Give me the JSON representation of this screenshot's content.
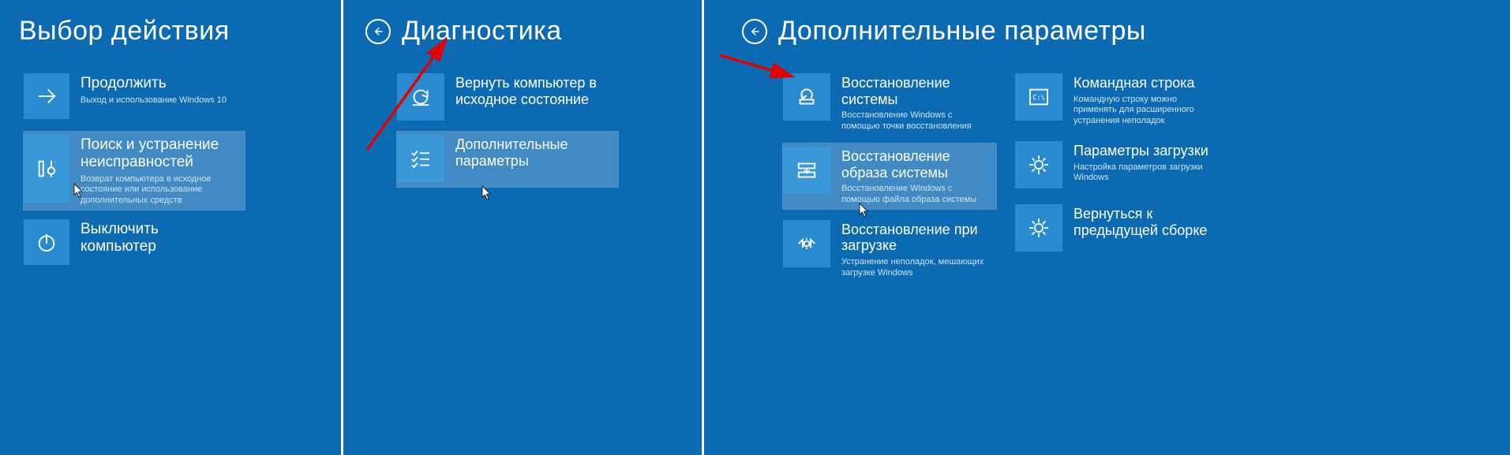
{
  "panel1": {
    "title": "Выбор действия",
    "tiles": [
      {
        "title": "Продолжить",
        "desc": "Выход и использование Windows 10"
      },
      {
        "title": "Поиск и устранение неисправностей",
        "desc": "Возврат компьютера в исходное состояние или использование дополнительных средств"
      },
      {
        "title": "Выключить компьютер",
        "desc": ""
      }
    ]
  },
  "panel2": {
    "title": "Диагностика",
    "tiles": [
      {
        "title": "Вернуть компьютер в исходное состояние",
        "desc": ""
      },
      {
        "title": "Дополнительные параметры",
        "desc": ""
      }
    ]
  },
  "panel3": {
    "title": "Дополнительные параметры",
    "col1": [
      {
        "title": "Восстановление системы",
        "desc": "Восстановление Windows с помощью точки восстановления"
      },
      {
        "title": "Восстановление образа системы",
        "desc": "Восстановление Windows с помощью файла образа системы"
      },
      {
        "title": "Восстановление при загрузке",
        "desc": "Устранение неполадок, мешающих загрузке Windows"
      }
    ],
    "col2": [
      {
        "title": "Командная строка",
        "desc": "Командную строку можно применять для расширенного устранения неполадок"
      },
      {
        "title": "Параметры загрузки",
        "desc": "Настройка параметров загрузки Windows"
      },
      {
        "title": "Вернуться к предыдущей сборке",
        "desc": ""
      }
    ]
  }
}
